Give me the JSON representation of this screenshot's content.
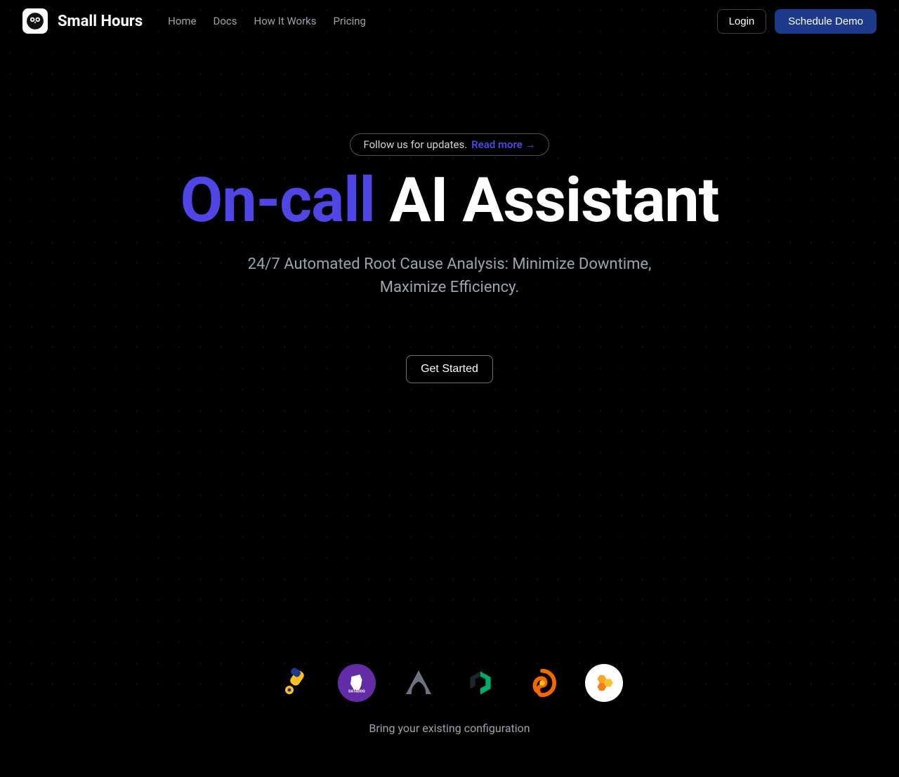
{
  "nav": {
    "brand": "Small Hours",
    "links": [
      "Home",
      "Docs",
      "How It Works",
      "Pricing"
    ],
    "login": "Login",
    "demo": "Schedule Demo"
  },
  "hero": {
    "follow_text": "Follow us for updates. ",
    "follow_link": "Read more →",
    "title_accent": "On-call",
    "title_rest": " AI Assistant",
    "subtitle_line1": "24/7 Automated Root Cause Analysis: Minimize Downtime,",
    "subtitle_line2": "Maximize Efficiency.",
    "cta": "Get Started"
  },
  "integrations": {
    "logos": [
      "telescope",
      "datadog",
      "sentry",
      "newrelic",
      "grafana",
      "honeycomb"
    ],
    "caption": "Bring your existing configuration"
  },
  "colors": {
    "accent": "#4f46e5",
    "primary_button": "#1e3a8a"
  }
}
